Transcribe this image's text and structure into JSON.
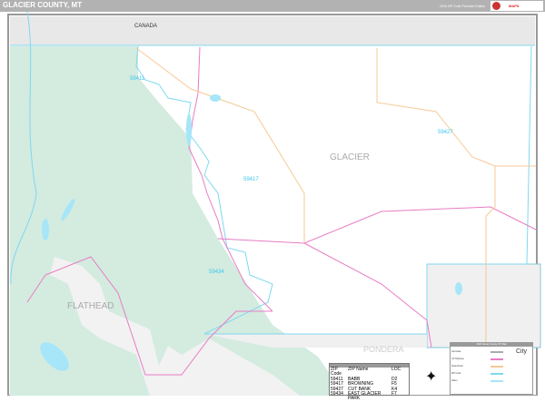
{
  "header": {
    "title": "GLACIER COUNTY, MT",
    "edition": "2026 ZIP Code Premium Edition",
    "logo_text": "MAPS"
  },
  "map": {
    "labels": {
      "canada": "CANADA",
      "county": "GLACIER",
      "flathead": "FLATHEAD",
      "pondera": "PONDERA"
    },
    "zip_labels": [
      "59411",
      "59417",
      "59427",
      "59434"
    ],
    "colors": {
      "park": "#d4ebe0",
      "water": "#a6e6f8",
      "zip_boundary": "#7fd8ef",
      "highway": "#e87cc4",
      "state_road": "#f5c996",
      "outside": "#efefef"
    }
  },
  "zip_table": {
    "headers": [
      "ZIP Code",
      "ZIP Name",
      "LOC"
    ],
    "rows": [
      [
        "59411",
        "BABB",
        "D2"
      ],
      [
        "59417",
        "BROWNING",
        "F5"
      ],
      [
        "59427",
        "CUT BANK",
        "K4"
      ],
      [
        "59434",
        "EAST GLACIER PARK",
        "F7"
      ]
    ]
  },
  "legend": {
    "title": "2026 Glacier County, MT Map",
    "city_label": "City",
    "items": [
      "Interstate",
      "US Highway",
      "State Road",
      "ZIP Code",
      "Water"
    ]
  }
}
